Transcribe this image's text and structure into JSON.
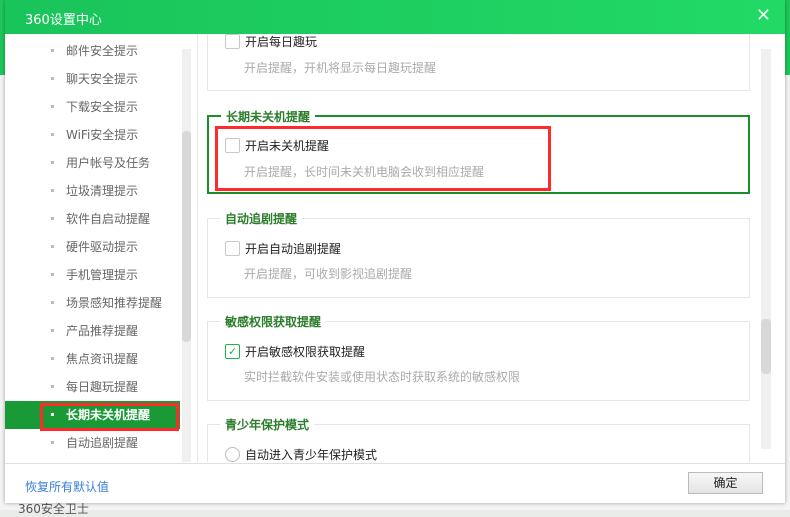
{
  "window": {
    "title": "360设置中心",
    "close_icon": "close-icon"
  },
  "background": {
    "app_text": "360安全卫士"
  },
  "sidebar": {
    "items": [
      {
        "label": "邮件安全提示"
      },
      {
        "label": "聊天安全提示"
      },
      {
        "label": "下载安全提示"
      },
      {
        "label": "WiFi安全提示"
      },
      {
        "label": "用户帐号及任务"
      },
      {
        "label": "垃圾清理提示"
      },
      {
        "label": "软件自启动提醒"
      },
      {
        "label": "硬件驱动提示"
      },
      {
        "label": "手机管理提示"
      },
      {
        "label": "场景感知推荐提醒"
      },
      {
        "label": "产品推荐提醒"
      },
      {
        "label": "焦点资讯提醒"
      },
      {
        "label": "每日趣玩提醒"
      },
      {
        "label": "长期未关机提醒",
        "active": true
      },
      {
        "label": "自动追剧提醒"
      }
    ]
  },
  "sections": [
    {
      "title": "",
      "option": "开启每日趣玩",
      "checked": false,
      "desc": "开启提醒，开机将显示每日趣玩提醒"
    },
    {
      "title": "长期未关机提醒",
      "option": "开启未关机提醒",
      "checked": false,
      "desc": "开启提醒，长时间未关机电脑会收到相应提醒"
    },
    {
      "title": "自动追剧提醒",
      "option": "开启自动追剧提醒",
      "checked": false,
      "desc": "开启提醒，可收到影视追剧提醒"
    },
    {
      "title": "敏感权限获取提醒",
      "option": "开启敏感权限获取提醒",
      "checked": true,
      "desc": "实时拦截软件安装或使用状态时获取系统的敏感权限"
    },
    {
      "title": "青少年保护模式",
      "option": "自动进入青少年保护模式",
      "checked": false
    }
  ],
  "footer": {
    "reset_label": "恢复所有默认值",
    "ok_label": "确定"
  },
  "colors": {
    "accent": "#1a9a37",
    "title_bar": "#1ec75a",
    "highlight": "#ff2b2b"
  }
}
